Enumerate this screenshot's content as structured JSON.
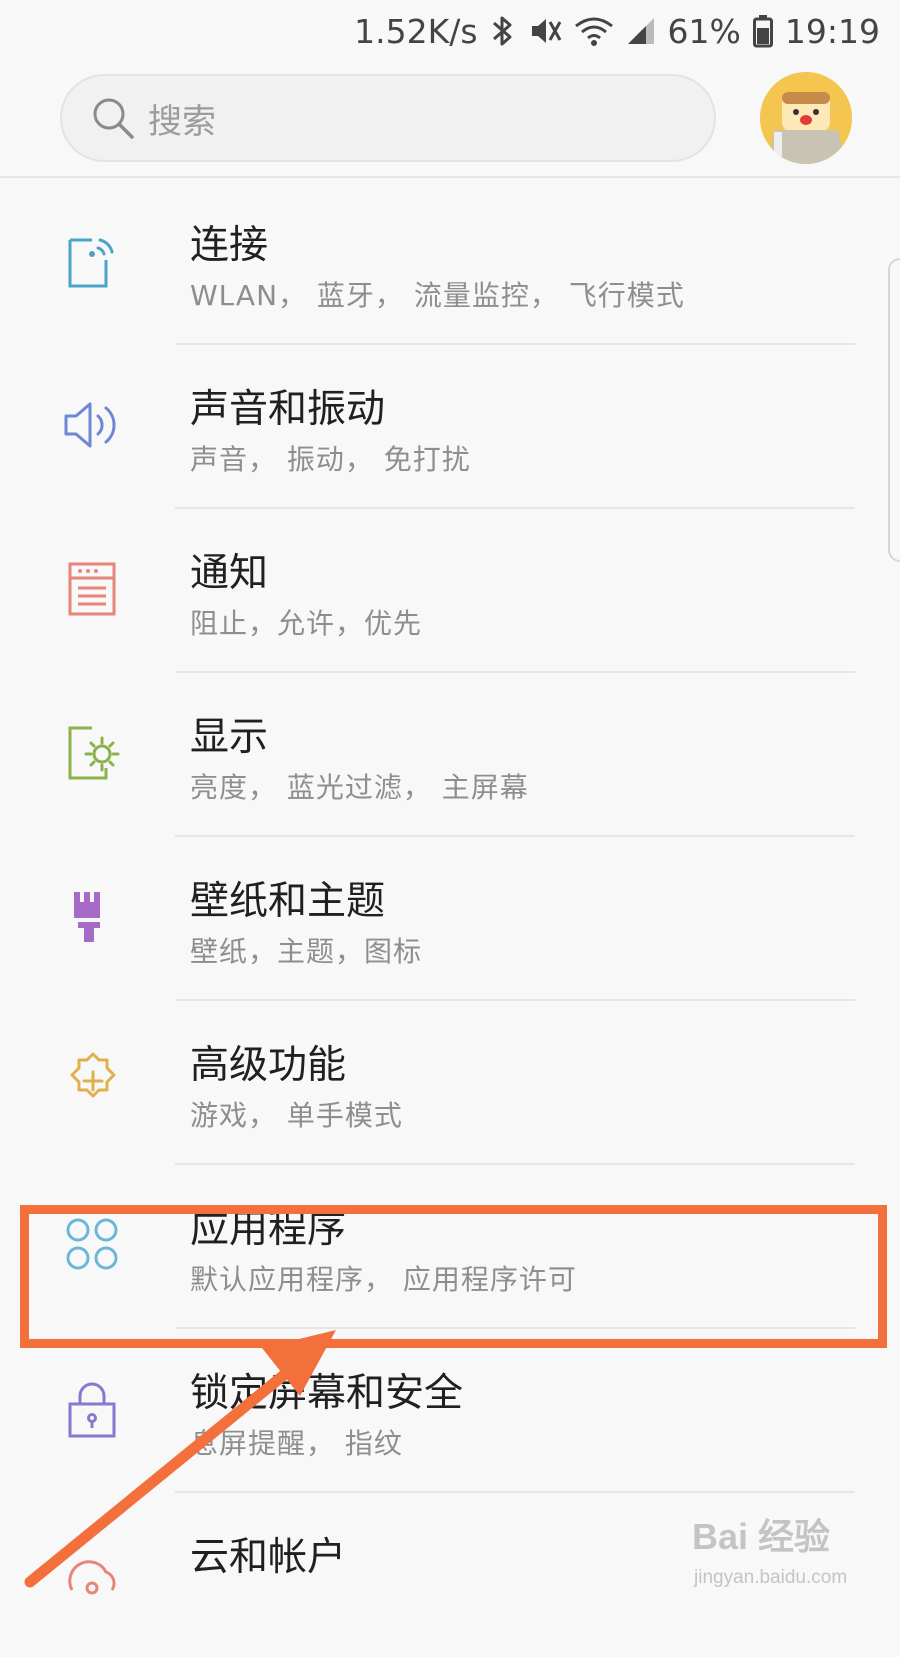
{
  "status_bar": {
    "net_speed": "1.52K/s",
    "battery": "61%",
    "time": "19:19",
    "icons": [
      "bluetooth-icon",
      "mute-icon",
      "wifi-icon",
      "signal-icon",
      "battery-icon"
    ]
  },
  "search": {
    "placeholder": "搜索"
  },
  "settings": [
    {
      "title": "连接",
      "subtitle": "WLAN， 蓝牙， 流量监控， 飞行模式",
      "icon": "connections-icon",
      "color": "#4aa4c8"
    },
    {
      "title": "声音和振动",
      "subtitle": "声音， 振动， 免打扰",
      "icon": "speaker-icon",
      "color": "#6d86d6"
    },
    {
      "title": "通知",
      "subtitle": "阻止，允许，优先",
      "icon": "notification-icon",
      "color": "#e8857a"
    },
    {
      "title": "显示",
      "subtitle": "亮度， 蓝光过滤， 主屏幕",
      "icon": "display-icon",
      "color": "#8ab14a"
    },
    {
      "title": "壁纸和主题",
      "subtitle": "壁纸，主题，图标",
      "icon": "brush-icon",
      "color": "#a56bc6"
    },
    {
      "title": "高级功能",
      "subtitle": "游戏， 单手模式",
      "icon": "advanced-gear-icon",
      "color": "#e0b04e"
    },
    {
      "title": "应用程序",
      "subtitle": "默认应用程序， 应用程序许可",
      "icon": "apps-icon",
      "color": "#6bb7d9"
    },
    {
      "title": "锁定屏幕和安全",
      "subtitle": "息屏提醒， 指纹",
      "icon": "lock-icon",
      "color": "#8a77cf"
    },
    {
      "title": "云和帐户",
      "subtitle": "",
      "icon": "cloud-account-icon",
      "color": "#e8857a"
    }
  ],
  "annotation": {
    "highlight_color": "#f36f3c"
  },
  "watermark": {
    "brand": "Bai 经验",
    "url": "jingyan.baidu.com"
  }
}
